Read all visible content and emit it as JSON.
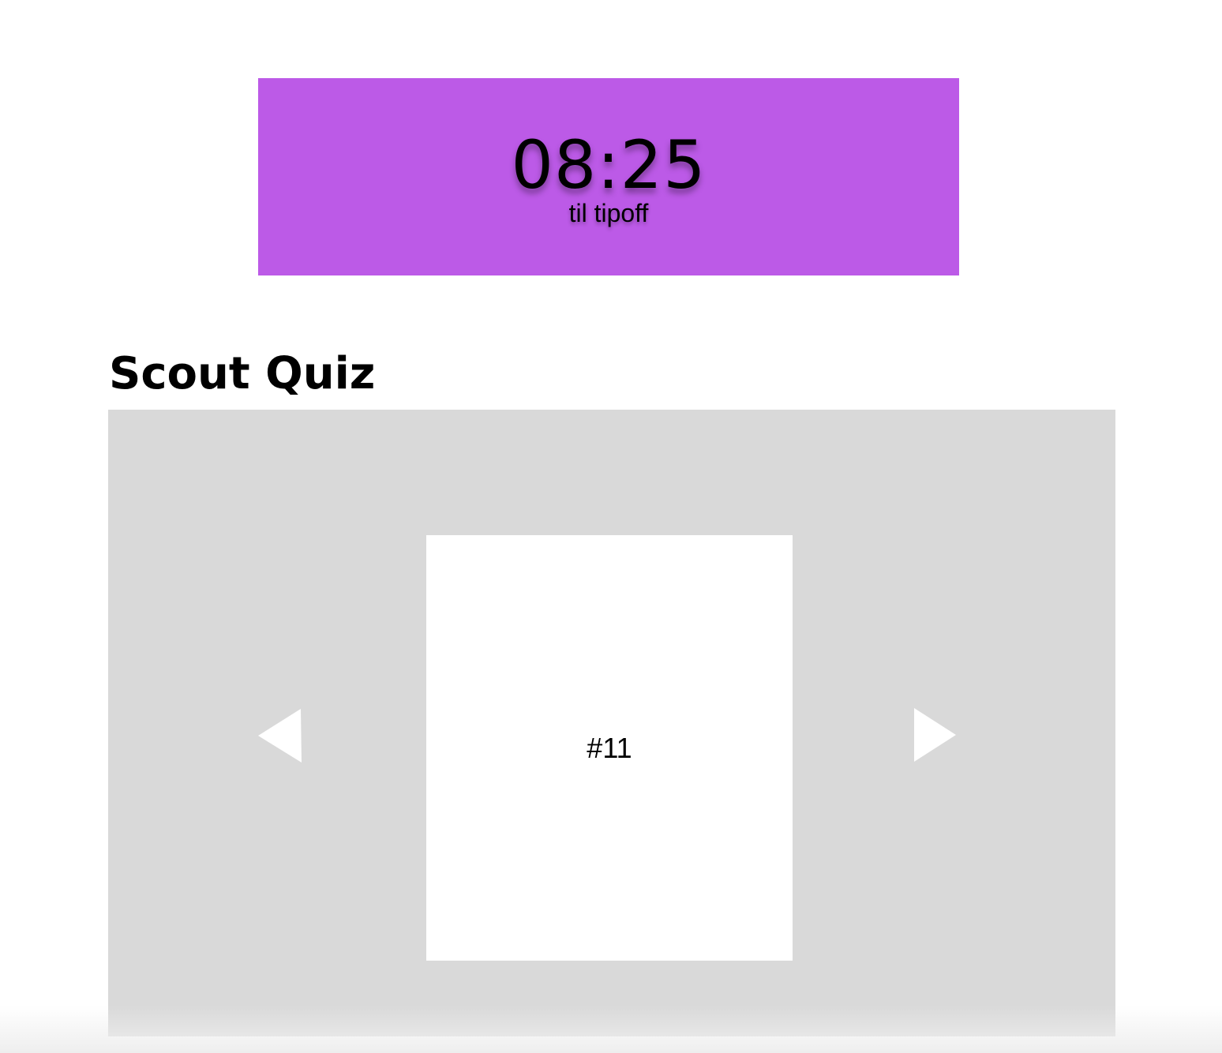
{
  "countdown": {
    "time": "08:25",
    "label": "til tipoff",
    "background_color": "#bc5ae7"
  },
  "quiz": {
    "title": "Scout Quiz",
    "card_label": "#11",
    "prev_icon": "triangle-left-icon",
    "next_icon": "triangle-right-icon",
    "panel_color": "#d9d9d9"
  }
}
